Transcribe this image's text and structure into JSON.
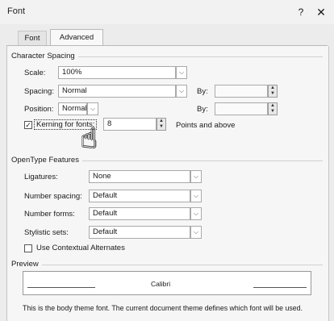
{
  "window": {
    "title": "Font",
    "help_glyph": "?",
    "close_glyph": "✕"
  },
  "tabs": [
    {
      "label": "Font",
      "active": false
    },
    {
      "label": "Advanced",
      "active": true
    }
  ],
  "character_spacing": {
    "heading": "Character Spacing",
    "scale": {
      "label": "Scale:",
      "value": "100%"
    },
    "spacing": {
      "label": "Spacing:",
      "value": "Normal",
      "by_label": "By:",
      "by_value": ""
    },
    "position": {
      "label": "Position:",
      "value": "Normal",
      "by_label": "By:",
      "by_value": ""
    },
    "kerning": {
      "label": "Kerning for fonts:",
      "checked": true,
      "value": "8",
      "suffix": "Points and above"
    }
  },
  "opentype": {
    "heading": "OpenType Features",
    "ligatures": {
      "label": "Ligatures:",
      "value": "None"
    },
    "number_spacing": {
      "label": "Number spacing:",
      "value": "Default"
    },
    "number_forms": {
      "label": "Number forms:",
      "value": "Default"
    },
    "stylistic_sets": {
      "label": "Stylistic sets:",
      "value": "Default"
    },
    "contextual_alternates": {
      "label": "Use Contextual Alternates",
      "checked": false
    }
  },
  "preview": {
    "heading": "Preview",
    "sample_text": "Calibri",
    "caption": "This is the body theme font. The current document theme defines which font will be used."
  },
  "glyphs": {
    "dropdown": "⌵",
    "spin_up": "▲",
    "spin_down": "▼",
    "check": "✓",
    "cursor": "☝"
  }
}
